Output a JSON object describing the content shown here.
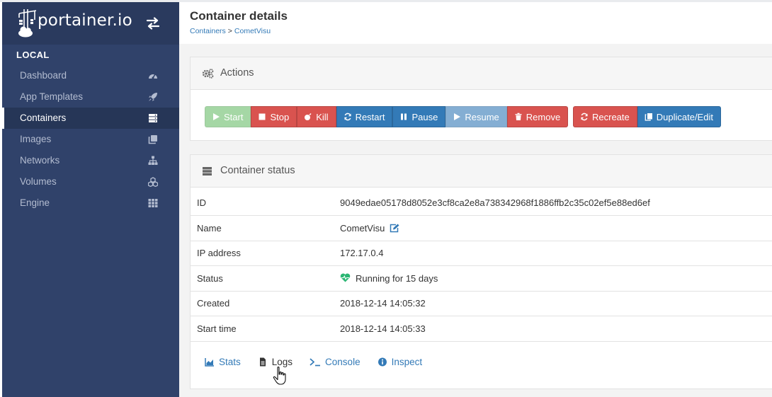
{
  "brand": {
    "logo_text": "portainer.io",
    "toggle_icon": "exchange-arrows-icon"
  },
  "sidebar": {
    "section_title": "LOCAL",
    "items": [
      {
        "label": "Dashboard",
        "icon": "tachometer-icon",
        "active": false
      },
      {
        "label": "App Templates",
        "icon": "rocket-icon",
        "active": false
      },
      {
        "label": "Containers",
        "icon": "server-icon",
        "active": true
      },
      {
        "label": "Images",
        "icon": "clone-icon",
        "active": false
      },
      {
        "label": "Networks",
        "icon": "sitemap-icon",
        "active": false
      },
      {
        "label": "Volumes",
        "icon": "cubes-icon",
        "active": false
      },
      {
        "label": "Engine",
        "icon": "th-icon",
        "active": false
      }
    ]
  },
  "header": {
    "title": "Container details",
    "breadcrumb": {
      "parent": "Containers",
      "separator": ">",
      "current": "CometVisu"
    }
  },
  "actions": {
    "title": "Actions",
    "buttons": {
      "start": "Start",
      "stop": "Stop",
      "kill": "Kill",
      "restart": "Restart",
      "pause": "Pause",
      "resume": "Resume",
      "remove": "Remove",
      "recreate": "Recreate",
      "duplicate": "Duplicate/Edit"
    }
  },
  "status": {
    "title": "Container status",
    "rows": [
      {
        "key": "ID",
        "value": "9049edae05178d8052e3cf8ca2e8a738342968f1886ffb2c35c02ef5e88ed6ef"
      },
      {
        "key": "Name",
        "value": "CometVisu"
      },
      {
        "key": "IP address",
        "value": "172.17.0.4"
      },
      {
        "key": "Status",
        "value": "Running for 15 days"
      },
      {
        "key": "Created",
        "value": "2018-12-14 14:05:32"
      },
      {
        "key": "Start time",
        "value": "2018-12-14 14:05:33"
      }
    ],
    "tabs": [
      {
        "label": "Stats",
        "icon": "area-chart-icon"
      },
      {
        "label": "Logs",
        "icon": "file-text-icon"
      },
      {
        "label": "Console",
        "icon": "terminal-icon"
      },
      {
        "label": "Inspect",
        "icon": "info-circle-icon"
      }
    ]
  },
  "colors": {
    "sidebar_bg": "#30426a",
    "link": "#337ab7",
    "success": "#5cb85c",
    "danger": "#d9534f",
    "primary": "#337ab7",
    "status_ok": "#2bb673"
  }
}
